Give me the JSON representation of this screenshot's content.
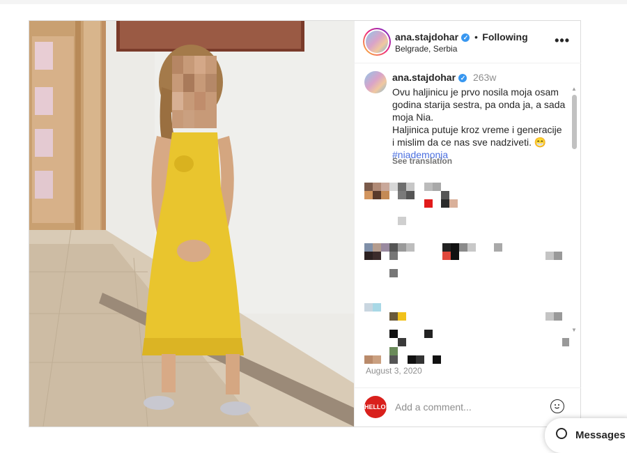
{
  "header": {
    "username": "ana.stajdohar",
    "follow_status": "Following",
    "separator": "•",
    "location": "Belgrade, Serbia",
    "more_label": "•••"
  },
  "caption": {
    "username": "ana.stajdohar",
    "age": "263w",
    "text_lines": [
      "Ovu haljinicu je prvo nosila moja osam",
      "godina starija sestra, pa onda ja, a sada",
      "moja Nia.",
      "Haljinica putuje kroz vreme i generacije",
      "i mislim da ce nas sve nadziveti. 😁"
    ],
    "hashtag": "#niademonja",
    "see_translation": "See translation"
  },
  "post_date": "August 3, 2020",
  "comment": {
    "brand_label": "HELLO!",
    "placeholder": "Add a comment..."
  },
  "messages": {
    "label": "Messages"
  },
  "colors": {
    "verified": "#3897f0",
    "hashtag": "#4a6fe0",
    "brand_red": "#d9201c",
    "dress_yellow": "#e9c52e"
  },
  "icons": {
    "verified": "verified-badge-icon",
    "more": "more-options-icon",
    "emoji": "emoji-icon",
    "messages": "messages-icon"
  }
}
